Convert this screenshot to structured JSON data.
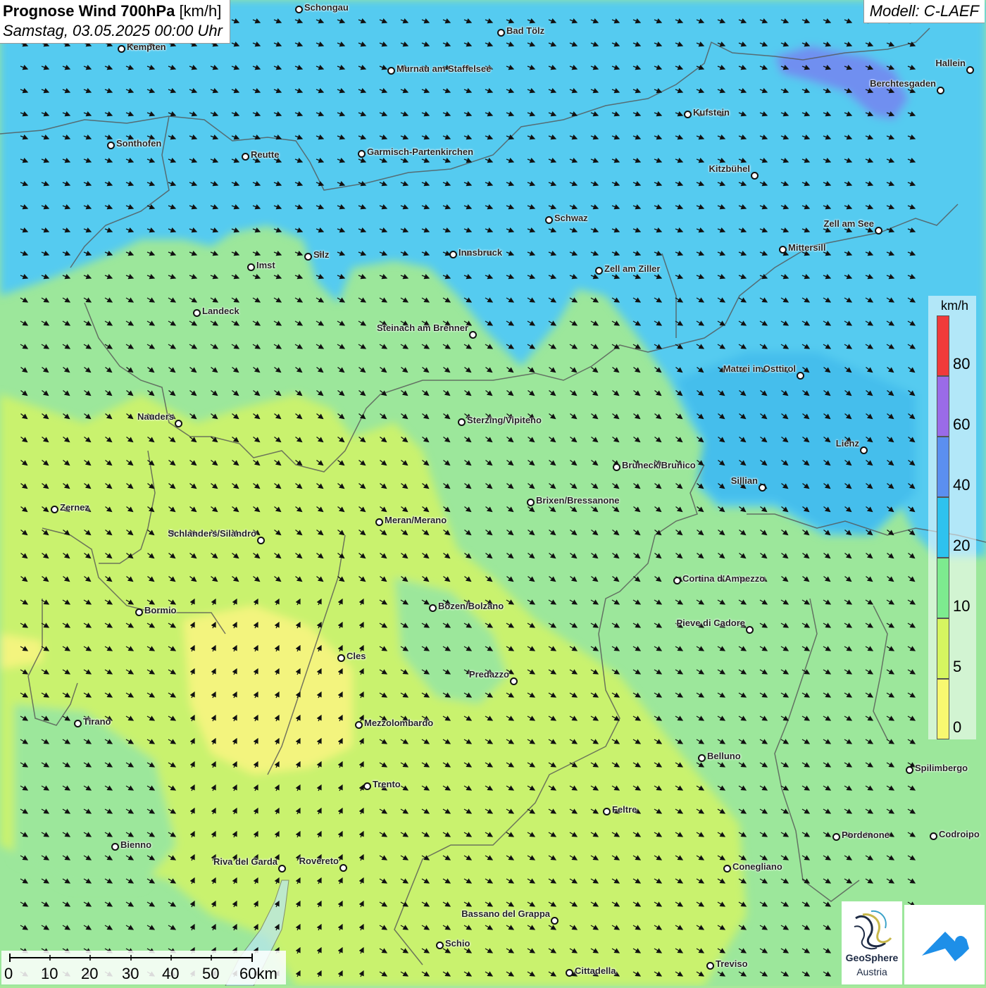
{
  "title": {
    "main_bold": "Prognose Wind 700hPa",
    "unit": "[km/h]",
    "datetime": "Samstag, 03.05.2025 00:00 Uhr"
  },
  "model": "Modell: C-LAEF",
  "legend": {
    "unit": "km/h",
    "classes": [
      {
        "label": "80",
        "color": "#f03a3a"
      },
      {
        "label": "60",
        "color": "#9a6be8"
      },
      {
        "label": "40",
        "color": "#5b8ff0"
      },
      {
        "label": "20",
        "color": "#2ec2ee"
      },
      {
        "label": "10",
        "color": "#7deb8f"
      },
      {
        "label": "5",
        "color": "#d6f560"
      },
      {
        "label": "0",
        "color": "#f8f870"
      }
    ]
  },
  "cities": [
    {
      "name": "Schongau"
    },
    {
      "name": "Bad Tölz"
    },
    {
      "name": "Kempten"
    },
    {
      "name": "Murnau am Staffelsee"
    },
    {
      "name": "Hallein"
    },
    {
      "name": "Berchtesgaden"
    },
    {
      "name": "Kufstein"
    },
    {
      "name": "Sonthofen"
    },
    {
      "name": "Reutte"
    },
    {
      "name": "Garmisch-Partenkirchen"
    },
    {
      "name": "Kitzbühel"
    },
    {
      "name": "Schwaz"
    },
    {
      "name": "Zell am See"
    },
    {
      "name": "Mittersill"
    },
    {
      "name": "Innsbruck"
    },
    {
      "name": "Silz"
    },
    {
      "name": "Imst"
    },
    {
      "name": "Zell am Ziller"
    },
    {
      "name": "Landeck"
    },
    {
      "name": "Steinach am Brenner"
    },
    {
      "name": "Matrei in Osttirol"
    },
    {
      "name": "Nauders"
    },
    {
      "name": "Sterzing/Vipiteno"
    },
    {
      "name": "Lienz"
    },
    {
      "name": "Bruneck/Brunico"
    },
    {
      "name": "Sillian"
    },
    {
      "name": "Brixen/Bressanone"
    },
    {
      "name": "Zernez"
    },
    {
      "name": "Meran/Merano"
    },
    {
      "name": "Schlanders/Silandro"
    },
    {
      "name": "Cortina d'Ampezzo"
    },
    {
      "name": "Bozen/Bolzano"
    },
    {
      "name": "Bormio"
    },
    {
      "name": "Pieve di Cadore"
    },
    {
      "name": "Cles"
    },
    {
      "name": "Predazzo"
    },
    {
      "name": "Tirano"
    },
    {
      "name": "Mezzolombardo"
    },
    {
      "name": "Belluno"
    },
    {
      "name": "Spilimbergo"
    },
    {
      "name": "Trento"
    },
    {
      "name": "Feltre"
    },
    {
      "name": "Pordenone"
    },
    {
      "name": "Codroipo"
    },
    {
      "name": "Bienno"
    },
    {
      "name": "Riva del Garda"
    },
    {
      "name": "Rovereto"
    },
    {
      "name": "Conegliano"
    },
    {
      "name": "Bassano del Grappa"
    },
    {
      "name": "Schio"
    },
    {
      "name": "Treviso"
    },
    {
      "name": "Cittadella"
    }
  ],
  "scale": {
    "labels": [
      "0",
      "10",
      "20",
      "30",
      "40",
      "50",
      "60km"
    ]
  },
  "logo": {
    "name_line1": "GeoSphere",
    "name_line2": "Austria"
  }
}
